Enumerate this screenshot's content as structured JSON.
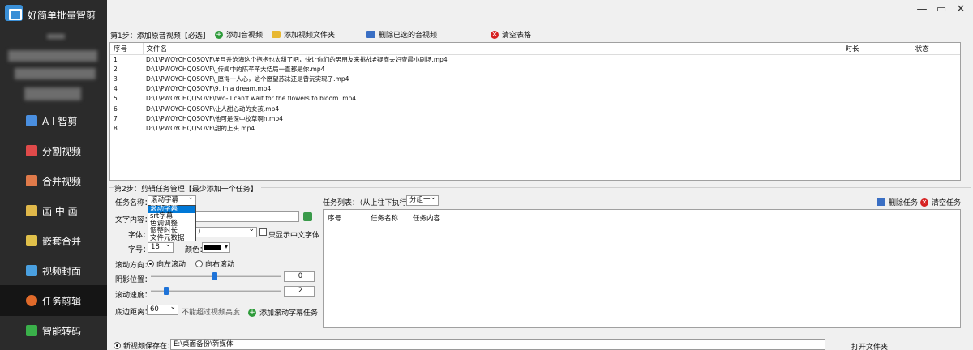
{
  "app": {
    "title": "好简单批量智剪"
  },
  "sidebar": {
    "items": [
      {
        "label": "A I 智剪",
        "icon": "ai-icon",
        "color": "#4a8fe0"
      },
      {
        "label": "分割视频",
        "icon": "split-video-icon",
        "color": "#e04a4a"
      },
      {
        "label": "合并视频",
        "icon": "merge-video-icon",
        "color": "#e07a4a"
      },
      {
        "label": "画 中 画",
        "icon": "picture-in-picture-icon",
        "color": "#e0b84a"
      },
      {
        "label": "嵌套合并",
        "icon": "nested-merge-icon",
        "color": "#e0c04a"
      },
      {
        "label": "视频封面",
        "icon": "video-cover-icon",
        "color": "#4aa0e0"
      },
      {
        "label": "任务剪辑",
        "icon": "task-edit-icon",
        "color": "#e06a2a"
      },
      {
        "label": "智能转码",
        "icon": "transcode-icon",
        "color": "#3ab04a"
      }
    ]
  },
  "step1": {
    "label": "第1步：添加原音视频【必选】",
    "add_media": "添加音视频",
    "add_folder": "添加视频文件夹",
    "delete_selected": "删除已选的音视频",
    "clear_table": "清空表格",
    "columns": [
      "序号",
      "文件名",
      "时长",
      "状态"
    ],
    "rows": [
      {
        "no": "1",
        "file": "D:\\1\\PWOYCHQQSOVF\\#月升沧海这个抱抱也太甜了吧，快让你们的男朋友来挑战#疑商夫妇查晨小剧场.mp4"
      },
      {
        "no": "2",
        "file": "D:\\1\\PWOYCHQQSOVF\\_传闻中的陈芊芊大结局一直都是你.mp4"
      },
      {
        "no": "3",
        "file": "D:\\1\\PWOYCHQQSOVF\\_愿得一人心，这个愿望苏沫还是曾沅实现了.mp4"
      },
      {
        "no": "4",
        "file": "D:\\1\\PWOYCHQQSOVF\\9. In a dream.mp4"
      },
      {
        "no": "5",
        "file": "D:\\1\\PWOYCHQQSOVF\\two- I can't wait for the flowers to bloom..mp4"
      },
      {
        "no": "6",
        "file": "D:\\1\\PWOYCHQQSOVF\\让人甜心动的女孩.mp4"
      },
      {
        "no": "7",
        "file": "D:\\1\\PWOYCHQQSOVF\\他可是深中校草啊n.mp4"
      },
      {
        "no": "8",
        "file": "D:\\1\\PWOYCHQQSOVF\\甜的上头.mp4"
      }
    ]
  },
  "step2": {
    "label": "第2步：剪辑任务管理【最少添加一个任务】",
    "task_name_label": "任务名称：",
    "task_name_value": "滚动字幕",
    "dropdown_options": [
      "滚动字幕",
      "srt字幕",
      "色调调整",
      "调整时长",
      "文件元数据"
    ],
    "text_content_label": "文字内容：",
    "font_label": "字体：",
    "font_value": ")",
    "only_chinese_label": "只显示中文字体",
    "size_label": "字号：",
    "size_value": "18",
    "color_label": "颜色：",
    "scroll_dir_label": "滚动方向：",
    "scroll_left": "向左滚动",
    "scroll_right": "向右滚动",
    "shadow_label": "阴影位置：",
    "shadow_value": "0",
    "speed_label": "滚动速度：",
    "speed_value": "2",
    "bottom_label": "底边距离：",
    "bottom_value": "60",
    "bottom_note": "不能超过视频高度",
    "add_task_btn": "添加滚动字幕任务"
  },
  "task_list": {
    "label": "任务列表：（从上往下执行）",
    "group_value": "分组一",
    "delete_task": "删除任务",
    "clear_tasks": "清空任务",
    "columns": [
      "序号",
      "任务名称",
      "任务内容"
    ]
  },
  "bottom": {
    "save_label": "新视频保存在：",
    "save_path": "E:\\桌面备份\\新媒体",
    "open_folder": "打开文件夹"
  }
}
